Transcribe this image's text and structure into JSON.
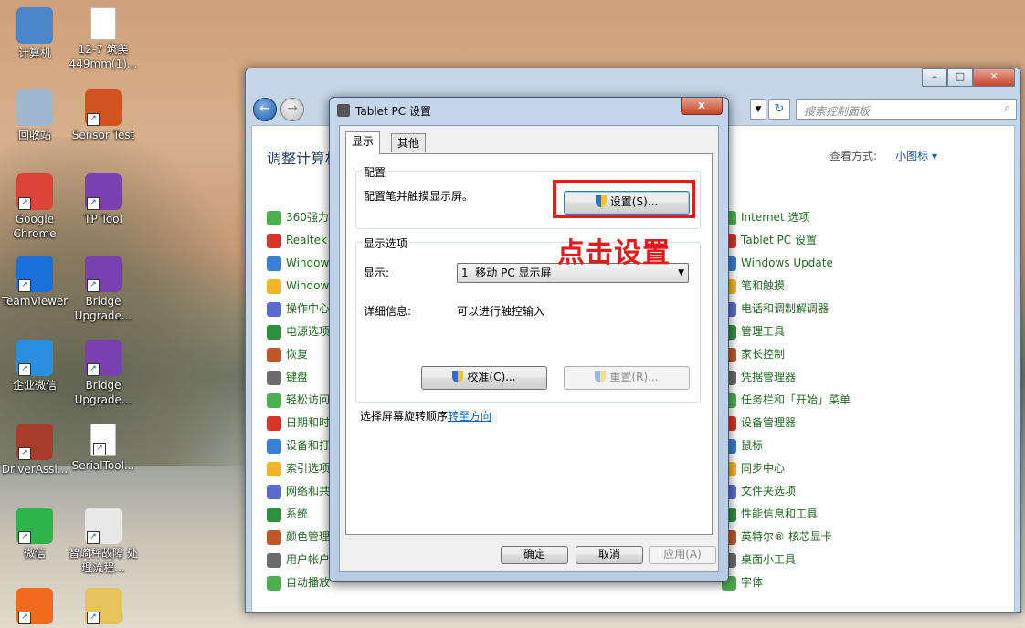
{
  "desktop": {
    "icons": [
      {
        "label": "计算机",
        "color": "#4a86c8"
      },
      {
        "label": "12-7 筑美 449mm(1)...",
        "color": "#ffffff"
      },
      {
        "label": "回收站",
        "color": "#9fb7d0"
      },
      {
        "label": "Sensor Test",
        "color": "#d0541e"
      },
      {
        "label": "Google Chrome",
        "color": "#db4437"
      },
      {
        "label": "TP Tool",
        "color": "#7a3fb0"
      },
      {
        "label": "TeamViewer",
        "color": "#1b6fd8"
      },
      {
        "label": "Bridge Upgrade...",
        "color": "#7a3fb0"
      },
      {
        "label": "企业微信",
        "color": "#2b8fe0"
      },
      {
        "label": "Bridge Upgrade...",
        "color": "#7a3fb0"
      },
      {
        "label": "DriverAssi...",
        "color": "#a83c2a"
      },
      {
        "label": "SerialTool...",
        "color": "#ffffff"
      },
      {
        "label": "微信",
        "color": "#2fb44a"
      },
      {
        "label": "智崎秤故障 处理流程...",
        "color": "#e8e8e8"
      },
      {
        "label": "",
        "color": "#f26a1b"
      },
      {
        "label": "",
        "color": "#e8c25a"
      }
    ]
  },
  "control_panel": {
    "search_placeholder": "搜索控制面板",
    "title": "调整计算机",
    "view_by_label": "查看方式:",
    "view_by_value": "小图标 ▾",
    "left_items": [
      "360强力卸",
      "Realtek",
      "Window",
      "Window",
      "操作中心",
      "电源选项",
      "恢复",
      "键盘",
      "轻松访问",
      "日期和时",
      "设备和打",
      "索引选项",
      "网络和共",
      "系统",
      "颜色管理",
      "用户帐户",
      "自动播放"
    ],
    "right_items": [
      "Internet 选项",
      "Tablet PC 设置",
      "Windows Update",
      "笔和触摸",
      "电话和调制解调器",
      "管理工具",
      "家长控制",
      "凭据管理器",
      "任务栏和「开始」菜单",
      "设备管理器",
      "鼠标",
      "同步中心",
      "文件夹选项",
      "性能信息和工具",
      "英特尔® 核芯显卡",
      "桌面小工具",
      "字体"
    ]
  },
  "dialog": {
    "title": "Tablet PC 设置",
    "close_label": "x",
    "tabs": [
      "显示",
      "其他"
    ],
    "config_group": "配置",
    "config_text": "配置笔并触摸显示屏。",
    "setup_button": "设置(S)...",
    "display_group": "显示选项",
    "display_label": "显示:",
    "display_value": "1. 移动 PC 显示屏",
    "details_label": "详细信息:",
    "details_value": "可以进行触控输入",
    "calibrate_button": "校准(C)...",
    "reset_button": "重置(R)...",
    "rotation_text": "选择屏幕旋转顺序",
    "rotation_link": "转至方向",
    "ok_button": "确定",
    "cancel_button": "取消",
    "apply_button": "应用(A)"
  },
  "annotation": {
    "text": "点击设置",
    "color": "#e61a1a"
  }
}
